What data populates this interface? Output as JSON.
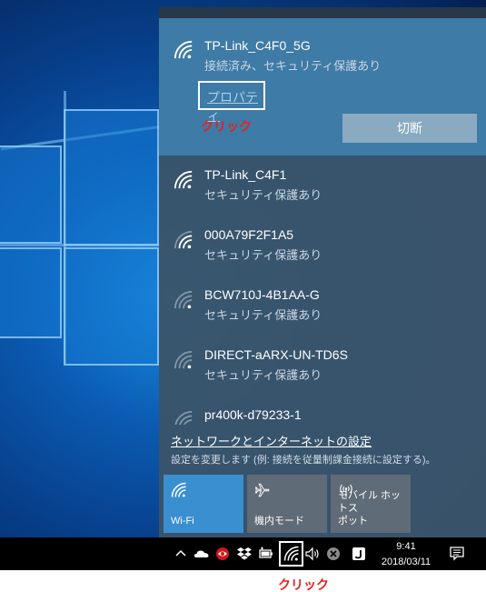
{
  "connected_network": {
    "ssid": "TP-Link_C4F0_5G",
    "status": "接続済み、セキュリティ保護あり",
    "properties_link": "プロパティ",
    "disconnect_label": "切断",
    "signal_icon": "wifi-signal-full-icon"
  },
  "networks": [
    {
      "ssid": "TP-Link_C4F1",
      "status": "セキュリティ保護あり",
      "signal_icon": "wifi-signal-full-icon"
    },
    {
      "ssid": "000A79F2F1A5",
      "status": "セキュリティ保護あり",
      "signal_icon": "wifi-signal-medium-icon"
    },
    {
      "ssid": "BCW710J-4B1AA-G",
      "status": "セキュリティ保護あり",
      "signal_icon": "wifi-signal-low-icon"
    },
    {
      "ssid": "DIRECT-aARX-UN-TD6S",
      "status": "セキュリティ保護あり",
      "signal_icon": "wifi-signal-low-icon"
    },
    {
      "ssid": "pr400k-d79233-1",
      "status": "",
      "signal_icon": "wifi-signal-low-icon"
    }
  ],
  "settings": {
    "link": "ネットワークとインターネットの設定",
    "description": "設定を変更します (例: 接続を従量制課金接続に設定する)。"
  },
  "quick_actions": [
    {
      "label": "Wi-Fi",
      "icon": "wifi-icon",
      "active": true
    },
    {
      "label": "機内モード",
      "icon": "airplane-icon",
      "active": false
    },
    {
      "label": "モバイル ホットス\nポット",
      "icon": "hotspot-icon",
      "active": false
    }
  ],
  "annotations": {
    "click_top": "クリック",
    "click_bottom": "クリック"
  },
  "taskbar": {
    "time": "9:41",
    "date": "2018/03/11",
    "tray_icons": [
      "chevron-up-icon",
      "onedrive-icon",
      "antivirus-icon",
      "dropbox-icon",
      "battery-icon",
      "wifi-icon",
      "speaker-icon",
      "close-circle-icon",
      "app-icon"
    ],
    "notification_icon": "action-center-icon"
  },
  "colors": {
    "flyout_bg": "#3a546a",
    "connected_bg": "#3e7ba6",
    "accent_tile": "#3a8fd0",
    "tile_inactive": "#5f6b76",
    "annotation_red": "#e8201c"
  }
}
